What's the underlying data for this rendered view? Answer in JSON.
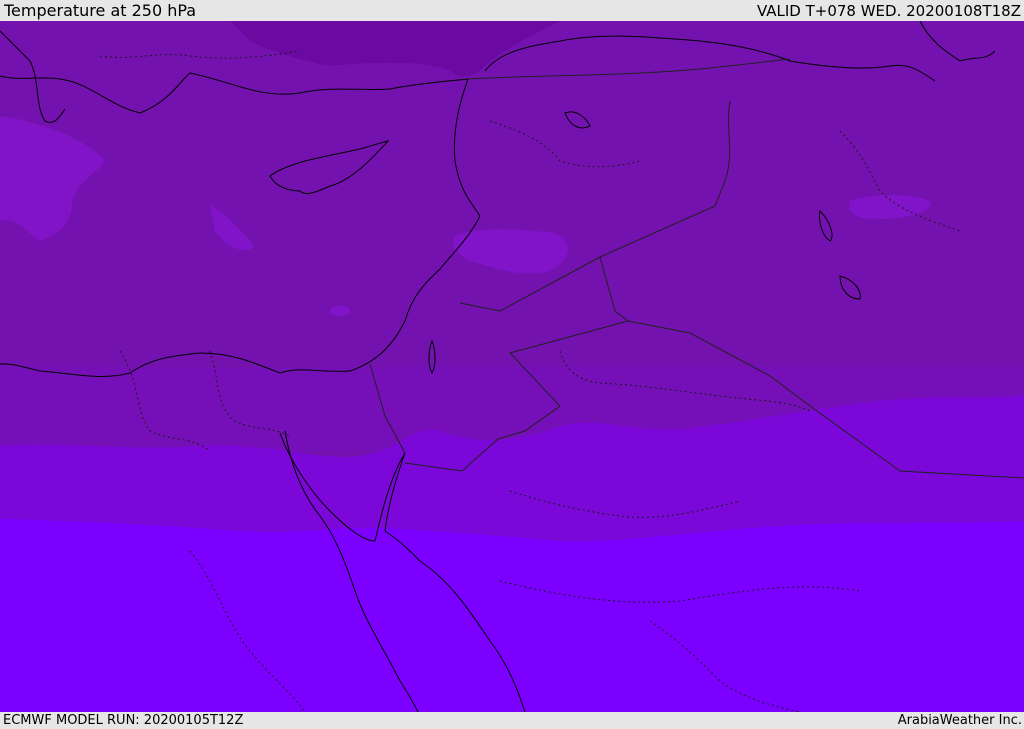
{
  "header": {
    "title": "Temperature at 250 hPa",
    "valid_time": "VALID T+078 WED. 20200108T18Z"
  },
  "footer": {
    "model_run": "ECMWF MODEL RUN: 20200105T12Z",
    "credit": "ArabiaWeather Inc."
  },
  "map": {
    "colors": {
      "band_coldest": "#6a0aa0",
      "band_cold": "#7412b0",
      "band_mid": "#7510b8",
      "band_warmer": "#7b08d8",
      "band_warmest": "#7b00ff",
      "patch_light": "#8a16d8",
      "coastline": "#000000",
      "border": "#202020"
    }
  }
}
